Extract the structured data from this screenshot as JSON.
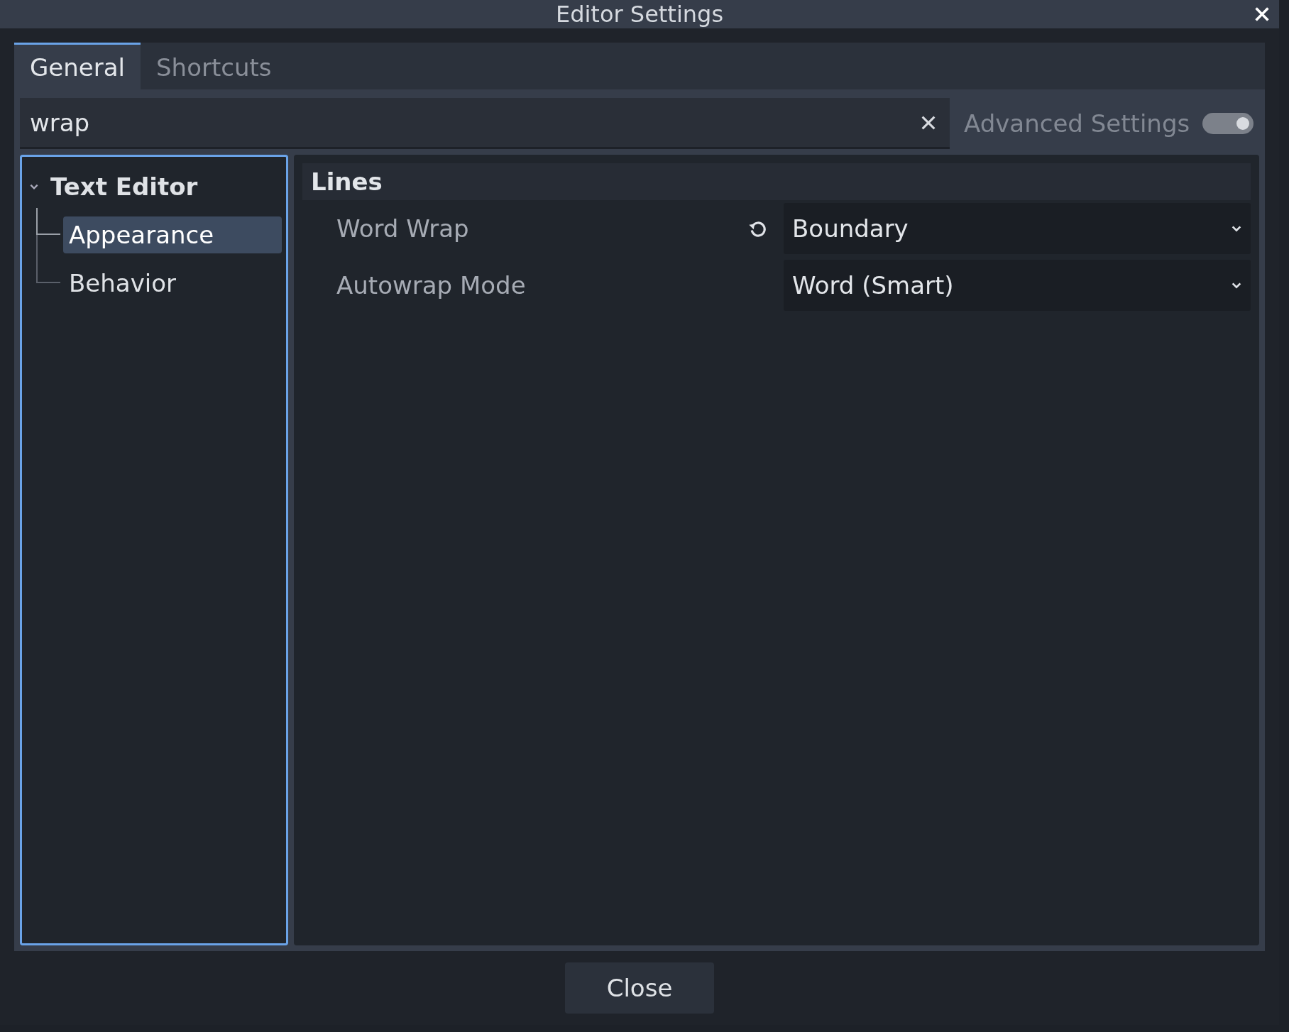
{
  "window": {
    "title": "Editor Settings"
  },
  "tabs": [
    {
      "label": "General",
      "selected": true
    },
    {
      "label": "Shortcuts",
      "selected": false
    }
  ],
  "search": {
    "value": "wrap"
  },
  "advanced_settings": {
    "label": "Advanced Settings",
    "on": true,
    "disabled": true
  },
  "tree": [
    {
      "label": "Text Editor",
      "expanded": true,
      "selected": false,
      "children": [
        {
          "label": "Appearance",
          "selected": true
        },
        {
          "label": "Behavior",
          "selected": false
        }
      ]
    }
  ],
  "section": {
    "title": "Lines",
    "properties": [
      {
        "label": "Word Wrap",
        "value": "Boundary",
        "modified": true
      },
      {
        "label": "Autowrap Mode",
        "value": "Word (Smart)",
        "modified": false
      }
    ]
  },
  "buttons": [
    {
      "label": "Close"
    }
  ]
}
